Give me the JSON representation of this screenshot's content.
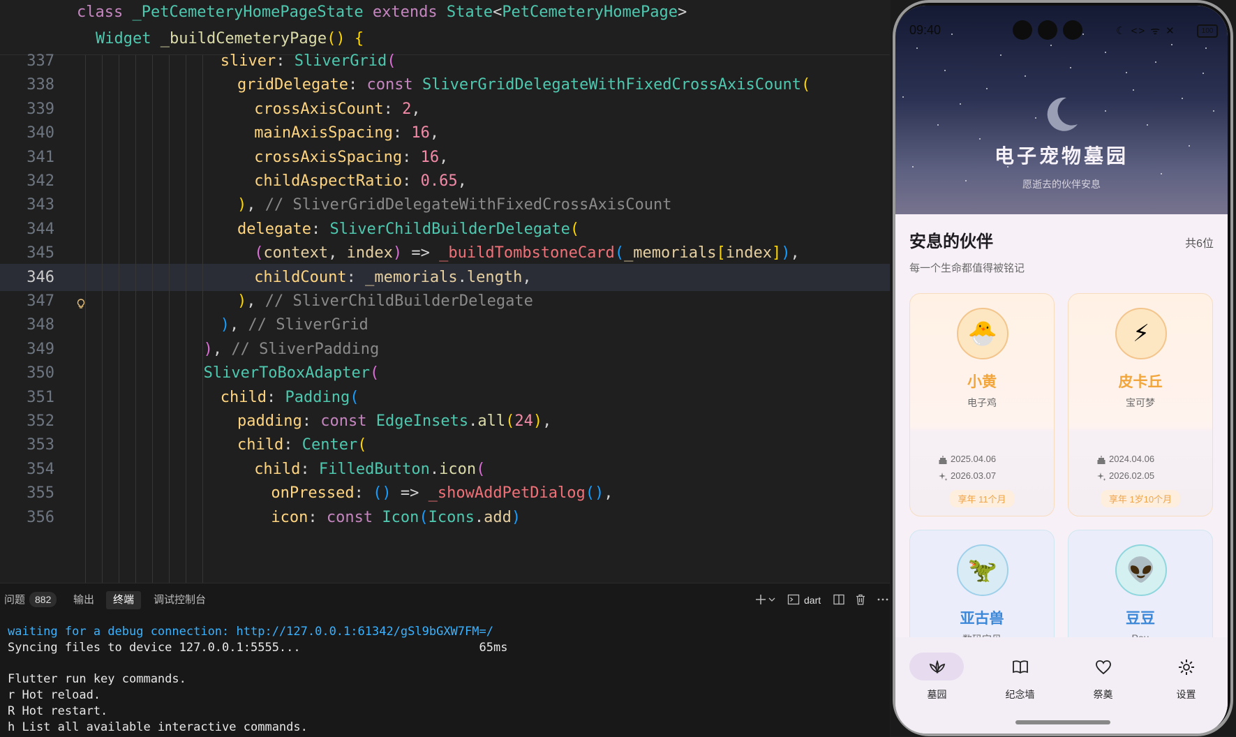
{
  "editor": {
    "sticky": [
      [
        [
          "kw",
          "class "
        ],
        [
          "cl",
          "_PetCemeteryHomePageState "
        ],
        [
          "kw",
          "extends "
        ],
        [
          "cl",
          "State"
        ],
        [
          "pu",
          "<"
        ],
        [
          "cl",
          "PetCemeteryHomePage"
        ],
        [
          "pu",
          ">"
        ]
      ],
      [
        [
          "cl",
          "Widget "
        ],
        [
          "fn",
          "_buildCemeteryPage"
        ],
        [
          "p1",
          "() "
        ],
        [
          "p1",
          "{"
        ]
      ]
    ],
    "active_line": "346",
    "lines": [
      {
        "n": "337",
        "indent": 9,
        "t": [
          [
            "prop",
            "sliver"
          ],
          [
            "pu",
            ": "
          ],
          [
            "cl",
            "SliverGrid"
          ],
          [
            "p2",
            "("
          ]
        ]
      },
      {
        "n": "338",
        "indent": 10,
        "t": [
          [
            "prop",
            "gridDelegate"
          ],
          [
            "pu",
            ": "
          ],
          [
            "kw",
            "const "
          ],
          [
            "cl",
            "SliverGridDelegateWithFixedCrossAxisCount"
          ],
          [
            "p1",
            "("
          ]
        ]
      },
      {
        "n": "339",
        "indent": 11,
        "t": [
          [
            "prop",
            "crossAxisCount"
          ],
          [
            "pu",
            ": "
          ],
          [
            "num",
            "2"
          ],
          [
            "pu",
            ","
          ]
        ]
      },
      {
        "n": "340",
        "indent": 11,
        "t": [
          [
            "prop",
            "mainAxisSpacing"
          ],
          [
            "pu",
            ": "
          ],
          [
            "num",
            "16"
          ],
          [
            "pu",
            ","
          ]
        ]
      },
      {
        "n": "341",
        "indent": 11,
        "t": [
          [
            "prop",
            "crossAxisSpacing"
          ],
          [
            "pu",
            ": "
          ],
          [
            "num",
            "16"
          ],
          [
            "pu",
            ","
          ]
        ]
      },
      {
        "n": "342",
        "indent": 11,
        "t": [
          [
            "prop",
            "childAspectRatio"
          ],
          [
            "pu",
            ": "
          ],
          [
            "num",
            "0.65"
          ],
          [
            "pu",
            ","
          ]
        ]
      },
      {
        "n": "343",
        "indent": 10,
        "t": [
          [
            "p1",
            ")"
          ],
          [
            "pu",
            ", "
          ],
          [
            "cmt",
            "// SliverGridDelegateWithFixedCrossAxisCount"
          ]
        ]
      },
      {
        "n": "344",
        "indent": 10,
        "t": [
          [
            "prop",
            "delegate"
          ],
          [
            "pu",
            ": "
          ],
          [
            "cl",
            "SliverChildBuilderDelegate"
          ],
          [
            "p1",
            "("
          ]
        ]
      },
      {
        "n": "345",
        "indent": 11,
        "t": [
          [
            "p2",
            "("
          ],
          [
            "var",
            "context"
          ],
          [
            "pu",
            ", "
          ],
          [
            "var",
            "index"
          ],
          [
            "p2",
            ") "
          ],
          [
            "pu",
            "=> "
          ],
          [
            "pink",
            "_buildTombstoneCard"
          ],
          [
            "p3",
            "("
          ],
          [
            "var",
            "_memorials"
          ],
          [
            "p1",
            "["
          ],
          [
            "var",
            "index"
          ],
          [
            "p1",
            "]"
          ],
          [
            "p3",
            ")"
          ],
          [
            "pu",
            ","
          ]
        ]
      },
      {
        "n": "346",
        "indent": 11,
        "t": [
          [
            "prop",
            "childCount"
          ],
          [
            "pu",
            ": "
          ],
          [
            "var",
            "_memorials"
          ],
          [
            "pu",
            "."
          ],
          [
            "var",
            "length"
          ],
          [
            "pu",
            ","
          ]
        ]
      },
      {
        "n": "347",
        "indent": 10,
        "t": [
          [
            "p1",
            ")"
          ],
          [
            "pu",
            ", "
          ],
          [
            "cmt",
            "// SliverChildBuilderDelegate"
          ]
        ]
      },
      {
        "n": "348",
        "indent": 9,
        "t": [
          [
            "p3",
            ")"
          ],
          [
            "pu",
            ", "
          ],
          [
            "cmt",
            "// SliverGrid"
          ]
        ]
      },
      {
        "n": "349",
        "indent": 8,
        "t": [
          [
            "p2",
            ")"
          ],
          [
            "pu",
            ", "
          ],
          [
            "cmt",
            "// SliverPadding"
          ]
        ]
      },
      {
        "n": "350",
        "indent": 8,
        "t": [
          [
            "cl",
            "SliverToBoxAdapter"
          ],
          [
            "p2",
            "("
          ]
        ]
      },
      {
        "n": "351",
        "indent": 9,
        "t": [
          [
            "prop",
            "child"
          ],
          [
            "pu",
            ": "
          ],
          [
            "cl",
            "Padding"
          ],
          [
            "p3",
            "("
          ]
        ]
      },
      {
        "n": "352",
        "indent": 10,
        "t": [
          [
            "prop",
            "padding"
          ],
          [
            "pu",
            ": "
          ],
          [
            "kw",
            "const "
          ],
          [
            "cl",
            "EdgeInsets"
          ],
          [
            "pu",
            "."
          ],
          [
            "fn",
            "all"
          ],
          [
            "p1",
            "("
          ],
          [
            "num",
            "24"
          ],
          [
            "p1",
            ")"
          ],
          [
            "pu",
            ","
          ]
        ]
      },
      {
        "n": "353",
        "indent": 10,
        "t": [
          [
            "prop",
            "child"
          ],
          [
            "pu",
            ": "
          ],
          [
            "cl",
            "Center"
          ],
          [
            "p1",
            "("
          ]
        ]
      },
      {
        "n": "354",
        "indent": 11,
        "t": [
          [
            "prop",
            "child"
          ],
          [
            "pu",
            ": "
          ],
          [
            "cl",
            "FilledButton"
          ],
          [
            "pu",
            "."
          ],
          [
            "fn",
            "icon"
          ],
          [
            "p2",
            "("
          ]
        ]
      },
      {
        "n": "355",
        "indent": 12,
        "t": [
          [
            "prop",
            "onPressed"
          ],
          [
            "pu",
            ": "
          ],
          [
            "p3",
            "() "
          ],
          [
            "pu",
            "=> "
          ],
          [
            "pink",
            "_showAddPetDialog"
          ],
          [
            "p3",
            "()"
          ],
          [
            "pu",
            ","
          ]
        ]
      },
      {
        "n": "356",
        "indent": 12,
        "t": [
          [
            "prop",
            "icon"
          ],
          [
            "pu",
            ": "
          ],
          [
            "kw",
            "const "
          ],
          [
            "cl",
            "Icon"
          ],
          [
            "p3",
            "("
          ],
          [
            "cl",
            "Icons"
          ],
          [
            "pu",
            "."
          ],
          [
            "var",
            "add"
          ],
          [
            "p3",
            ")"
          ]
        ]
      }
    ]
  },
  "panel": {
    "tabs": {
      "problems": "问题",
      "problems_count": "882",
      "output": "输出",
      "terminal": "终端",
      "debug_console": "调试控制台"
    },
    "shell_label": "dart",
    "terminal_lines": [
      {
        "text": "waiting for a debug connection: http://127.0.0.1:61342/gSl9bGXW7FM=/",
        "style": "blue"
      },
      {
        "text": "Syncing files to device 127.0.0.1:5555...                         65ms",
        "style": "normal"
      },
      {
        "text": "",
        "style": "normal"
      },
      {
        "text": "Flutter run key commands.",
        "style": "normal"
      },
      {
        "text": "r Hot reload.",
        "style": "normal"
      },
      {
        "text": "R Hot restart.",
        "style": "normal"
      },
      {
        "text": "h List all available interactive commands.",
        "style": "normal"
      }
    ]
  },
  "phone": {
    "status_time": "09:40",
    "status_icons": "☾ <> ᯤ ✕",
    "battery": "100",
    "app_title": "电子宠物墓园",
    "app_subtitle": "愿逝去的伙伴安息",
    "section_title": "安息的伙伴",
    "section_count": "共6位",
    "section_subtitle": "每一个生命都值得被铭记",
    "pets": [
      {
        "name": "小黄",
        "type": "电子鸡",
        "emoji": "🐣",
        "born": "2025.04.06",
        "died": "2026.03.07",
        "age": "享年 11个月",
        "theme": "orange",
        "card": "warm"
      },
      {
        "name": "皮卡丘",
        "type": "宝可梦",
        "emoji": "⚡",
        "born": "2024.04.06",
        "died": "2026.02.05",
        "age": "享年 1岁10个月",
        "theme": "orange",
        "card": "warm"
      },
      {
        "name": "亚古兽",
        "type": "数码宝贝",
        "emoji": "🦖",
        "theme": "blue",
        "card": "cool"
      },
      {
        "name": "豆豆",
        "type": "Pou",
        "emoji": "👽",
        "theme": "teal",
        "card": "cool"
      }
    ],
    "nav": [
      {
        "label": "墓园",
        "icon": "lotus-icon",
        "active": true
      },
      {
        "label": "纪念墙",
        "icon": "book-icon",
        "active": false
      },
      {
        "label": "祭奠",
        "icon": "heart-icon",
        "active": false
      },
      {
        "label": "设置",
        "icon": "gear-icon",
        "active": false
      }
    ],
    "colors": {
      "accent_orange": "#f1a53a",
      "accent_blue": "#3b87d8",
      "nav_active": "#e7dbf0"
    }
  }
}
